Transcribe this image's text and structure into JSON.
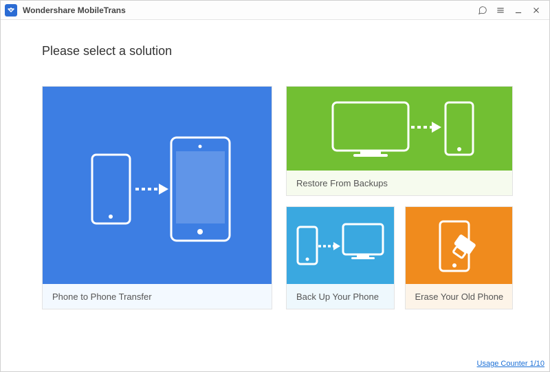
{
  "title": "Wondershare MobileTrans",
  "heading": "Please select a solution",
  "cards": {
    "transfer": "Phone to Phone Transfer",
    "restore": "Restore From Backups",
    "backup": "Back Up Your Phone",
    "erase": "Erase Your Old Phone"
  },
  "footer": {
    "usage_counter": "Usage Counter 1/10"
  },
  "colors": {
    "transfer": "#3d7ee3",
    "restore": "#72bf33",
    "backup": "#3aa8e0",
    "erase": "#f08b1d"
  }
}
